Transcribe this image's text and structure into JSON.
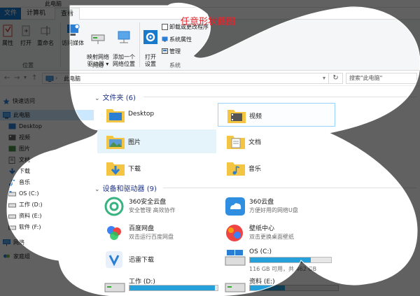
{
  "window": {
    "title": "此电脑"
  },
  "tabs": [
    "文件",
    "计算机",
    "查看"
  ],
  "ribbon": {
    "left_group": [
      "属性",
      "打开",
      "重命名"
    ],
    "left_group_label": "位置",
    "network": [
      "访问媒体",
      "映射网络\n驱动器 ▾",
      "添加一个\n网络位置"
    ],
    "network_label": "网络",
    "system": {
      "open_settings": "打开\n设置",
      "uninstall": "卸载或更改程序",
      "system_props": "系统属性",
      "manage": "管理"
    },
    "system_label": "系统"
  },
  "address": {
    "crumb": "此电脑",
    "search_placeholder": "搜索\"此电脑\""
  },
  "nav": [
    {
      "label": "快速访问",
      "icon": "star-icon"
    },
    {
      "label": "此电脑",
      "icon": "computer-icon",
      "selected": true
    },
    {
      "label": "Desktop",
      "icon": "desktop-folder-icon"
    },
    {
      "label": "视频",
      "icon": "video-folder-icon"
    },
    {
      "label": "图片",
      "icon": "picture-folder-icon"
    },
    {
      "label": "文档",
      "icon": "document-folder-icon"
    },
    {
      "label": "下载",
      "icon": "download-icon"
    },
    {
      "label": "音乐",
      "icon": "music-icon"
    },
    {
      "label": "OS (C:)",
      "icon": "drive-icon"
    },
    {
      "label": "工作 (D:)",
      "icon": "drive-icon"
    },
    {
      "label": "资料 (E:)",
      "icon": "drive-icon"
    },
    {
      "label": "软件 (F:)",
      "icon": "drive-icon"
    },
    {
      "label": "网络",
      "icon": "network-icon"
    },
    {
      "label": "家庭组",
      "icon": "homegroup-icon"
    }
  ],
  "folders_section": "文件夹 (6)",
  "folders": [
    "Desktop",
    "视频",
    "图片",
    "文档",
    "下载",
    "音乐"
  ],
  "devices_section": "设备和驱动器 (9)",
  "devices": [
    {
      "name": "360安全云盘",
      "sub": "安全管理 高效协作",
      "icon": "360-secure-cloud-icon"
    },
    {
      "name": "360云盘",
      "sub": "方便好用的网络U盘",
      "icon": "360-cloud-icon"
    },
    {
      "name": "百度网盘",
      "sub": "双击运行百度网盘",
      "icon": "baidu-netdisk-icon"
    },
    {
      "name": "壁纸中心",
      "sub": "双击更换桌面壁纸",
      "icon": "wallpaper-center-icon"
    },
    {
      "name": "迅雷下载",
      "sub": "",
      "icon": "xunlei-icon"
    },
    {
      "name": "OS (C:)",
      "space": "116 GB 可用，共 462 GB",
      "used_fraction": 0.75,
      "icon": "windows-drive-icon"
    },
    {
      "name": "工作 (D:)",
      "space": "",
      "used_fraction": 0.97,
      "icon": "drive-icon"
    },
    {
      "name": "资料 (E:)",
      "space": "",
      "used_fraction": 0.4,
      "icon": "drive-icon"
    }
  ],
  "overlay": {
    "title": "任意形状截图",
    "color": "#e8242b"
  }
}
